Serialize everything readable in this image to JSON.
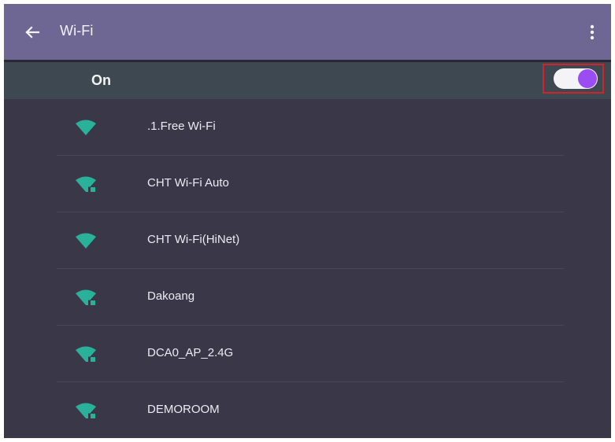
{
  "appbar": {
    "title": "Wi-Fi"
  },
  "wifi_switch": {
    "label": "On",
    "enabled": true
  },
  "networks": [
    {
      "ssid": ".1.Free Wi-Fi",
      "secured": false
    },
    {
      "ssid": "CHT Wi-Fi Auto",
      "secured": true
    },
    {
      "ssid": "CHT Wi-Fi(HiNet)",
      "secured": false
    },
    {
      "ssid": "Dakoang",
      "secured": true
    },
    {
      "ssid": "DCA0_AP_2.4G",
      "secured": true
    },
    {
      "ssid": "DEMOROOM",
      "secured": true
    }
  ],
  "colors": {
    "appbar": "#6e6793",
    "background": "#3a3748",
    "switch_bar": "#3e4851",
    "toggle_on": "#9b4cf3",
    "wifi_icon": "#2ab19a",
    "highlight": "#d2232a"
  }
}
